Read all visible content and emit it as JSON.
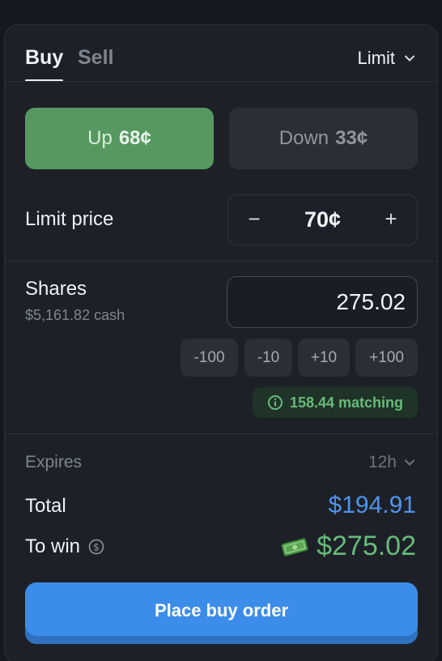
{
  "tabs": {
    "buy": "Buy",
    "sell": "Sell"
  },
  "order_type": "Limit",
  "outcomes": {
    "up": {
      "label": "Up",
      "price": "68¢"
    },
    "down": {
      "label": "Down",
      "price": "33¢"
    }
  },
  "limit_price": {
    "label": "Limit price",
    "value": "70¢",
    "minus": "−",
    "plus": "+"
  },
  "shares": {
    "label": "Shares",
    "cash": "$5,161.82 cash",
    "value": "275.02",
    "chips": [
      "-100",
      "-10",
      "+10",
      "+100"
    ],
    "matching": "158.44 matching"
  },
  "summary": {
    "expires_label": "Expires",
    "expires_value": "12h",
    "total_label": "Total",
    "total_value": "$194.91",
    "to_win_label": "To win",
    "to_win_value": "$275.02"
  },
  "action": {
    "place_label": "Place buy order"
  },
  "colors": {
    "up_green": "#56985f",
    "accent_blue": "#3c8de9",
    "win_green": "#67ba79",
    "total_blue": "#4f93ee"
  },
  "icons": {
    "order_type_dropdown": "chevron-down-icon",
    "matching": "info-icon",
    "to_win_info": "dollar-circle-icon",
    "to_win_money": "cash-icon"
  }
}
